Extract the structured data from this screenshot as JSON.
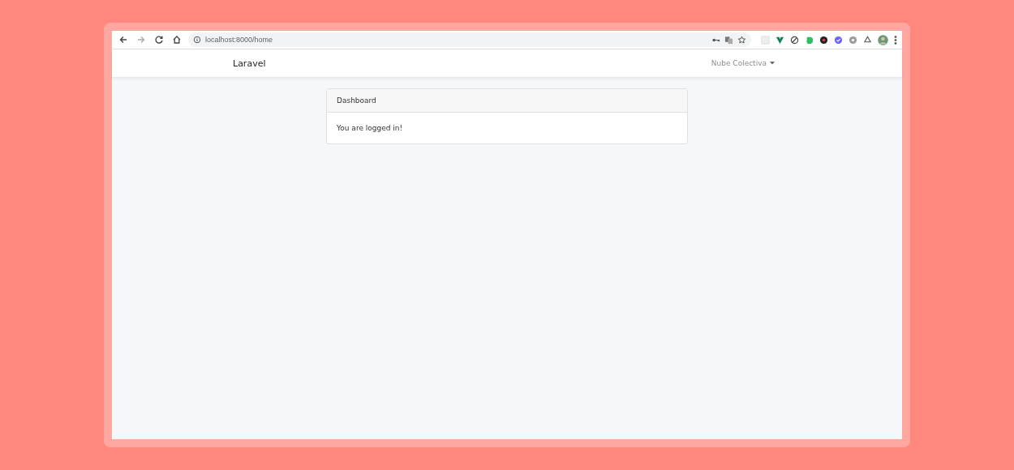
{
  "browser": {
    "url": "localhost:8000/home"
  },
  "navbar": {
    "brand": "Laravel",
    "user_menu": "Nube Colectiva",
    "user_menu_open": false
  },
  "card": {
    "header": "Dashboard",
    "body": "You are logged in!"
  }
}
